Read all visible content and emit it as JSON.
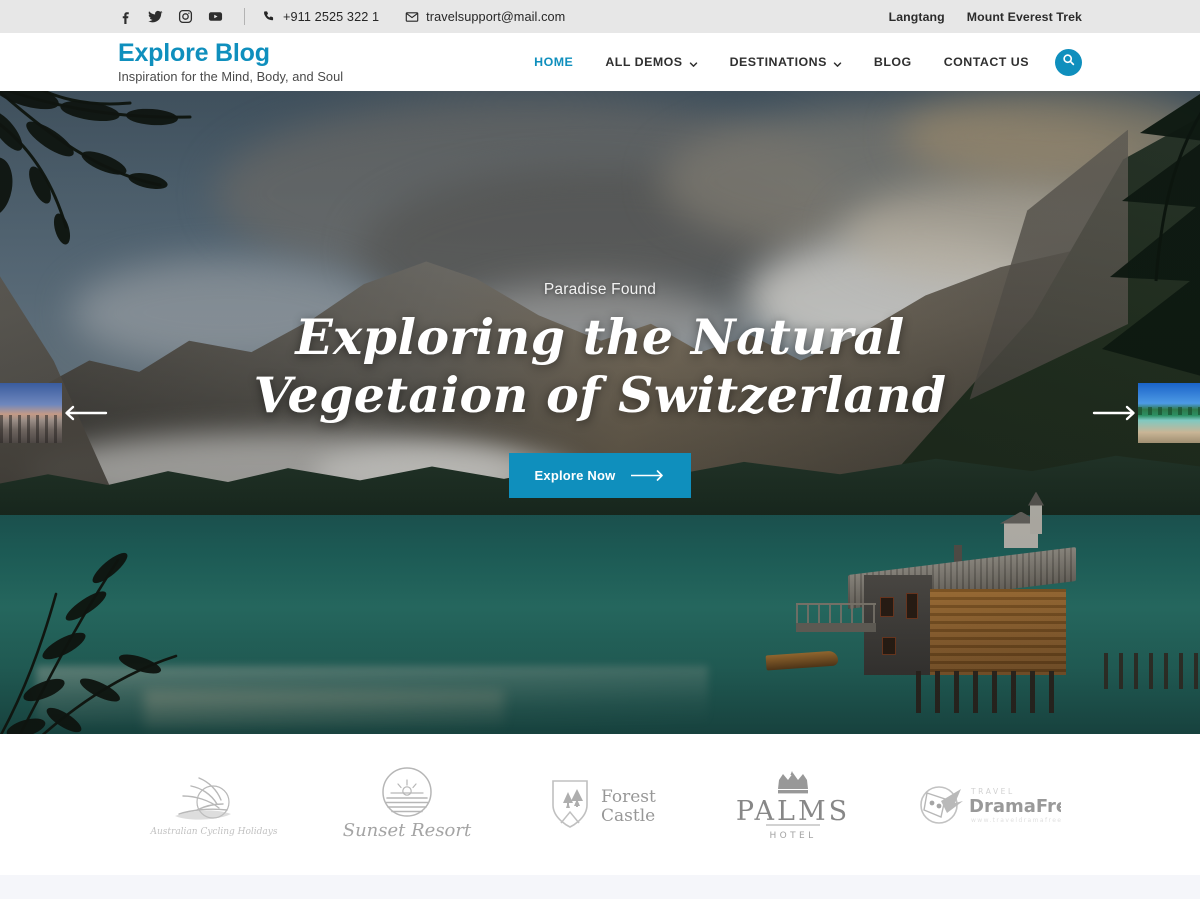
{
  "topbar": {
    "social": [
      {
        "name": "facebook-icon",
        "label": "Facebook"
      },
      {
        "name": "twitter-icon",
        "label": "Twitter"
      },
      {
        "name": "instagram-icon",
        "label": "Instagram"
      },
      {
        "name": "youtube-icon",
        "label": "YouTube"
      }
    ],
    "phone": "+911 2525 322 1",
    "email": "travelsupport@mail.com",
    "links": [
      {
        "label": "Langtang"
      },
      {
        "label": "Mount Everest Trek"
      }
    ]
  },
  "header": {
    "brand": "Explore Blog",
    "tagline": "Inspiration for the Mind, Body, and Soul",
    "nav": [
      {
        "label": "HOME",
        "active": true,
        "dropdown": false
      },
      {
        "label": "ALL DEMOS",
        "active": false,
        "dropdown": true
      },
      {
        "label": "DESTINATIONS",
        "active": false,
        "dropdown": true
      },
      {
        "label": "BLOG",
        "active": false,
        "dropdown": false
      },
      {
        "label": "CONTACT US",
        "active": false,
        "dropdown": false
      }
    ],
    "search_icon": "search-icon"
  },
  "hero": {
    "subtitle": "Paradise Found",
    "title": "Exploring the Natural Vegetaion of Switzerland",
    "cta_label": "Explore Now",
    "prev_label": "Previous slide",
    "next_label": "Next slide",
    "thumb_prev_alt": "City promenade at dusk",
    "thumb_next_alt": "Tropical beach with palm trees"
  },
  "logos": [
    {
      "name": "australian-cycling-holidays",
      "label": "Australian Cycling Holidays"
    },
    {
      "name": "sunset-resort",
      "label": "Sunset Resort"
    },
    {
      "name": "forest-castle",
      "label": "Forest Castle"
    },
    {
      "name": "palms-hotel",
      "label": "PALMS",
      "sub": "HOTEL"
    },
    {
      "name": "travel-dramafree",
      "label": "DramaFree",
      "sub": "TRAVEL"
    }
  ],
  "colors": {
    "accent": "#0f8fbd",
    "topbar_bg": "#e7e7e7",
    "header_bg": "#ffffff",
    "text_dark": "#2b2b2b",
    "bottom_strip": "#f5f6fa"
  }
}
